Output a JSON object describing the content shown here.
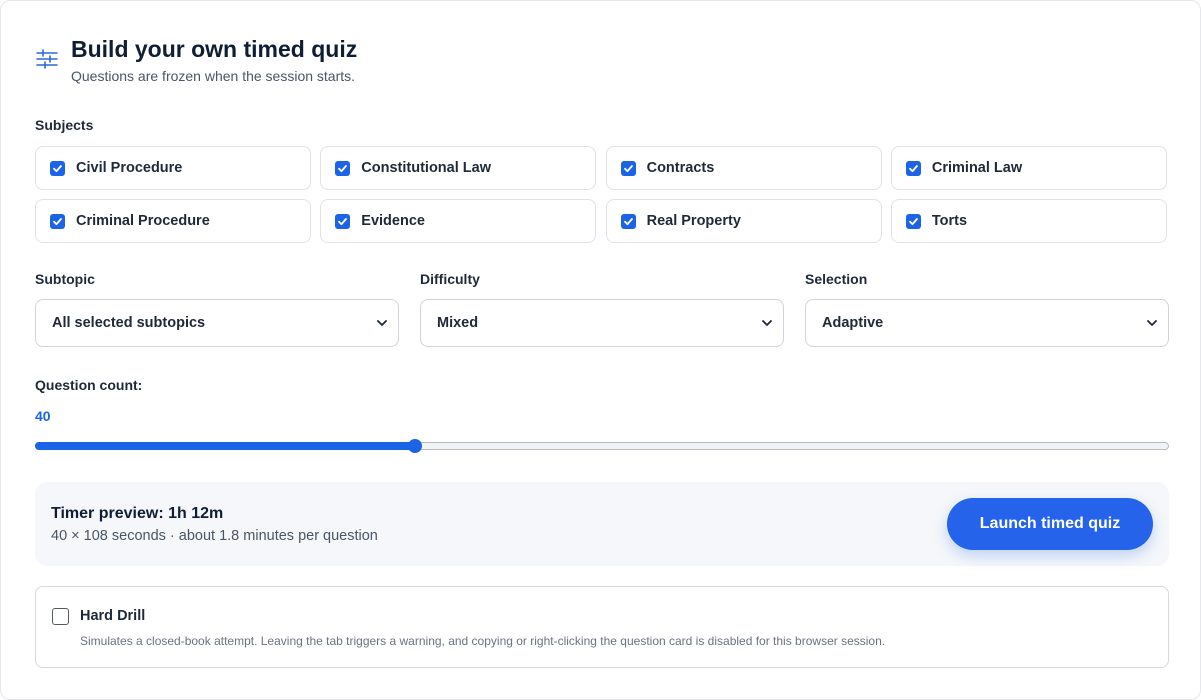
{
  "header": {
    "icon": "sliders-icon",
    "title": "Build your own timed quiz",
    "subtitle": "Questions are frozen when the session starts."
  },
  "subjects": {
    "label": "Subjects",
    "items": [
      {
        "label": "Civil Procedure",
        "checked": true
      },
      {
        "label": "Constitutional Law",
        "checked": true
      },
      {
        "label": "Contracts",
        "checked": true
      },
      {
        "label": "Criminal Law",
        "checked": true
      },
      {
        "label": "Criminal Procedure",
        "checked": true
      },
      {
        "label": "Evidence",
        "checked": true
      },
      {
        "label": "Real Property",
        "checked": true
      },
      {
        "label": "Torts",
        "checked": true
      }
    ]
  },
  "filters": {
    "subtopic": {
      "label": "Subtopic",
      "value": "All selected subtopics"
    },
    "difficulty": {
      "label": "Difficulty",
      "value": "Mixed"
    },
    "selection": {
      "label": "Selection",
      "value": "Adaptive"
    }
  },
  "question_count": {
    "label": "Question count:",
    "value": "40",
    "slider_fraction": 0.335
  },
  "timer": {
    "title": "Timer preview: 1h 12m",
    "detail": "40 × 108 seconds · about 1.8 minutes per question",
    "launch_label": "Launch timed quiz"
  },
  "hard_drill": {
    "title": "Hard Drill",
    "checked": false,
    "description": "Simulates a closed-book attempt. Leaving the tab triggers a warning, and copying or right-clicking the question card is disabled for this browser session."
  },
  "colors": {
    "accent": "#1c64e6",
    "button": "#2563eb",
    "heading": "#0f1d35"
  }
}
